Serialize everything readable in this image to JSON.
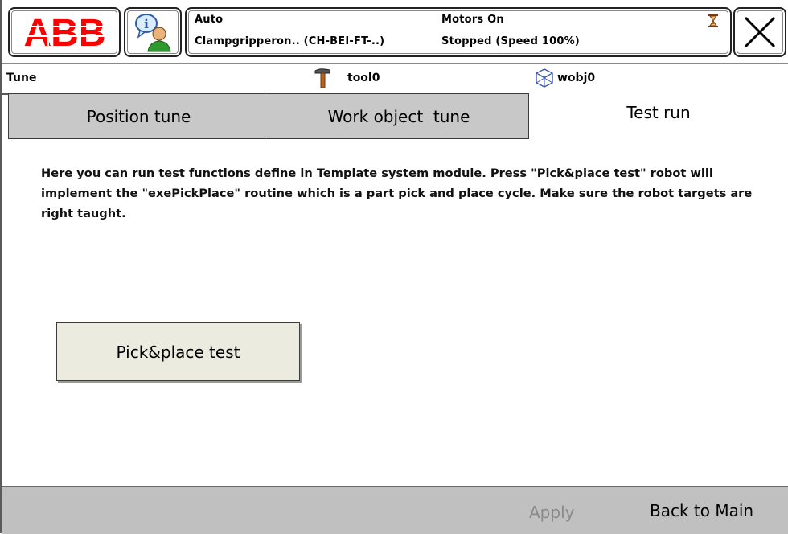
{
  "topbar": {
    "logo_text": "ABB",
    "mode": "Auto",
    "task": "Clampgripperon.. (CH-BEI-FT-..)",
    "motors": "Motors On",
    "run_state": "Stopped (Speed 100%)",
    "icons": [
      "abb-logo",
      "user-info-icon",
      "hourglass-icon",
      "close-icon"
    ]
  },
  "infobar": {
    "view": "Tune",
    "tool": "tool0",
    "wobj": "wobj0",
    "icons": [
      "tool-icon",
      "wobj-icon"
    ]
  },
  "tabs": [
    {
      "label": "Position tune"
    },
    {
      "label": "Work object  tune"
    },
    {
      "label": "Test run"
    }
  ],
  "content": {
    "description": "Here you can run test functions define in Template system module. Press \"Pick&place test\" robot will implement the \"exePickPlace\" routine which is a part pick and place cycle. Make sure the robot targets are right taught.",
    "pick_place_button": "Pick&place test"
  },
  "footer": {
    "apply": "Apply",
    "back": "Back to Main"
  },
  "colors": {
    "abb_red": "#ff0000",
    "tab_inactive": "#c8c8c8",
    "footer_bg": "#c0c0c0",
    "button_bg": "#ecebe0",
    "disabled_text": "#8a8a8a"
  }
}
